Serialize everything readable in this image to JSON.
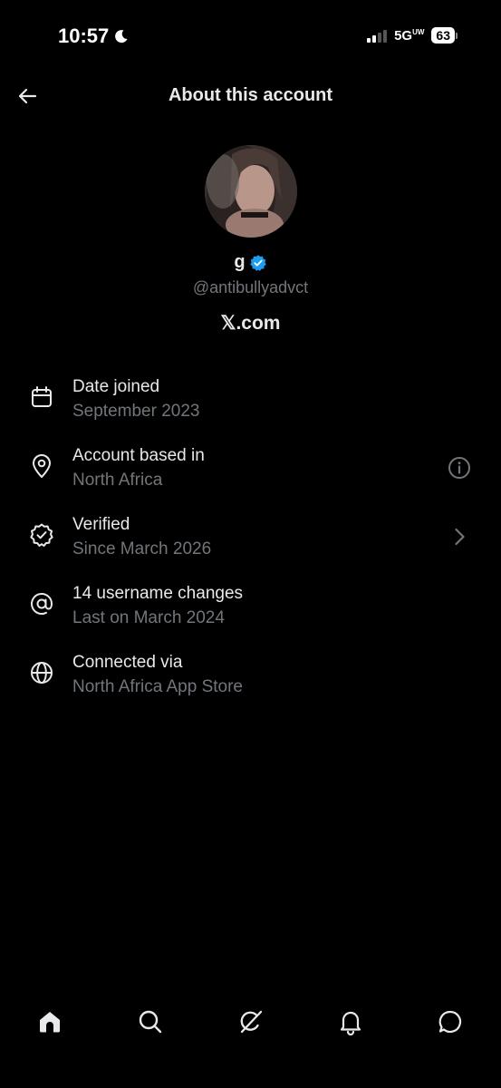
{
  "status_bar": {
    "time": "10:57",
    "network": "5G",
    "network_sup": "UW",
    "battery": "63"
  },
  "header": {
    "title": "About this account"
  },
  "profile": {
    "display_name": "g",
    "handle": "@antibullyadvct",
    "site": "𝕏.com",
    "verified_color": "#1d9bf0"
  },
  "info_items": [
    {
      "icon": "calendar-icon",
      "title": "Date joined",
      "subtitle": "September 2023"
    },
    {
      "icon": "location-pin-icon",
      "title": "Account based in",
      "subtitle": "North Africa",
      "trailing": "info-icon"
    },
    {
      "icon": "verified-badge-icon",
      "title": "Verified",
      "subtitle": "Since March 2026",
      "trailing": "chevron-right-icon"
    },
    {
      "icon": "at-sign-icon",
      "title": "14 username changes",
      "subtitle": "Last on March 2024"
    },
    {
      "icon": "globe-icon",
      "title": "Connected via",
      "subtitle": "North Africa App Store"
    }
  ],
  "bottom_nav": [
    "home-icon",
    "search-icon",
    "grok-icon",
    "notifications-bell-icon",
    "messages-icon"
  ],
  "colors": {
    "background": "#000000",
    "primary_text": "#e7e9ea",
    "secondary_text": "#71767b"
  }
}
